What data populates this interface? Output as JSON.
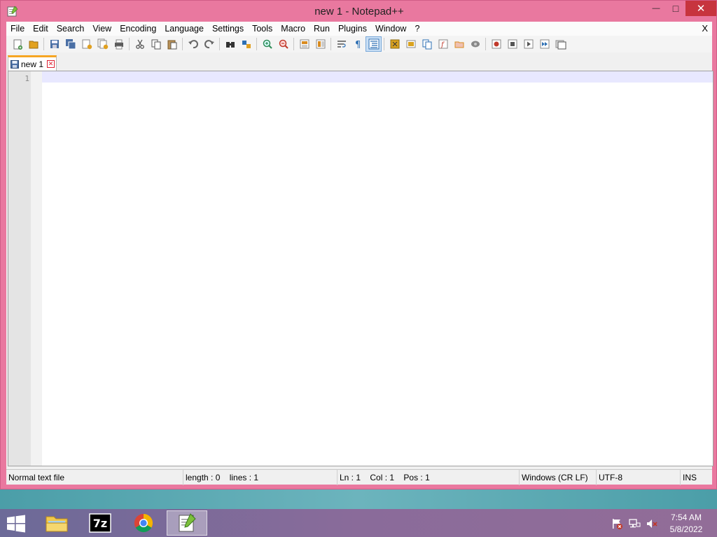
{
  "window": {
    "title": "new 1 - Notepad++",
    "min_glyph": "—",
    "max_glyph": "□",
    "close_glyph": "✕"
  },
  "menu": {
    "items": [
      "File",
      "Edit",
      "Search",
      "View",
      "Encoding",
      "Language",
      "Settings",
      "Tools",
      "Macro",
      "Run",
      "Plugins",
      "Window",
      "?"
    ],
    "close_label": "X"
  },
  "toolbar": {
    "buttons": [
      {
        "icon": "new-file-icon",
        "color": "#3c8d3c"
      },
      {
        "icon": "open-file-icon",
        "color": "#e2a21f"
      },
      {
        "icon": "save-icon",
        "color": "#4a6fa5"
      },
      {
        "icon": "save-all-icon",
        "color": "#4a6fa5"
      },
      {
        "icon": "close-icon",
        "color": "#b04a4a"
      },
      {
        "icon": "close-all-icon",
        "color": "#b04a4a"
      },
      {
        "icon": "print-icon",
        "color": "#5a5a5a"
      },
      {
        "icon": "cut-icon",
        "color": "#555"
      },
      {
        "icon": "copy-icon",
        "color": "#555"
      },
      {
        "icon": "paste-icon",
        "color": "#555"
      },
      {
        "icon": "undo-icon",
        "color": "#666"
      },
      {
        "icon": "redo-icon",
        "color": "#666"
      },
      {
        "icon": "find-icon",
        "color": "#333"
      },
      {
        "icon": "replace-icon",
        "color": "#2d6fb3"
      },
      {
        "icon": "zoom-in-icon",
        "color": "#2e8b57"
      },
      {
        "icon": "zoom-out-icon",
        "color": "#c0392b"
      },
      {
        "icon": "sync-vertical-icon",
        "color": "#d98b1f"
      },
      {
        "icon": "sync-horizontal-icon",
        "color": "#d98b1f"
      },
      {
        "icon": "word-wrap-icon",
        "color": "#555"
      },
      {
        "icon": "show-all-chars-icon",
        "color": "#2d6fb3"
      },
      {
        "icon": "indent-guide-icon",
        "color": "#2d6fb3"
      },
      {
        "icon": "udl-icon",
        "color": "#d9a21f"
      },
      {
        "icon": "doc-map-icon",
        "color": "#d9a21f"
      },
      {
        "icon": "doc-list-icon",
        "color": "#2d6fb3"
      },
      {
        "icon": "function-list-icon",
        "color": "#c0392b"
      },
      {
        "icon": "folder-workspace-icon",
        "color": "#d98b1f"
      },
      {
        "icon": "monitoring-icon",
        "color": "#888"
      },
      {
        "icon": "record-macro-icon",
        "color": "#c0392b"
      },
      {
        "icon": "stop-macro-icon",
        "color": "#555"
      },
      {
        "icon": "play-macro-icon",
        "color": "#555"
      },
      {
        "icon": "run-macro-multiple-icon",
        "color": "#2d6fb3"
      },
      {
        "icon": "save-macro-icon",
        "color": "#555"
      }
    ],
    "separators_after": [
      1,
      6,
      9,
      11,
      13,
      15,
      17,
      20,
      26
    ]
  },
  "tab": {
    "label": "new 1"
  },
  "editor": {
    "line_number": "1",
    "accent_color": "#f6a623"
  },
  "status": {
    "file_type": "Normal text file",
    "length": "length : 0",
    "lines": "lines : 1",
    "ln": "Ln : 1",
    "col": "Col : 1",
    "pos": "Pos : 1",
    "eol": "Windows (CR LF)",
    "encoding": "UTF-8",
    "mode": "INS"
  },
  "taskbar": {
    "apps": [
      {
        "name": "file-explorer",
        "icon": "folder-icon"
      },
      {
        "name": "7zip",
        "icon": "7zip-icon",
        "label": "7z"
      },
      {
        "name": "chrome",
        "icon": "chrome-icon"
      },
      {
        "name": "notepad-plus-plus",
        "icon": "notepad-icon",
        "active": true
      }
    ],
    "clock_time": "7:54 AM",
    "clock_date": "5/8/2022"
  }
}
